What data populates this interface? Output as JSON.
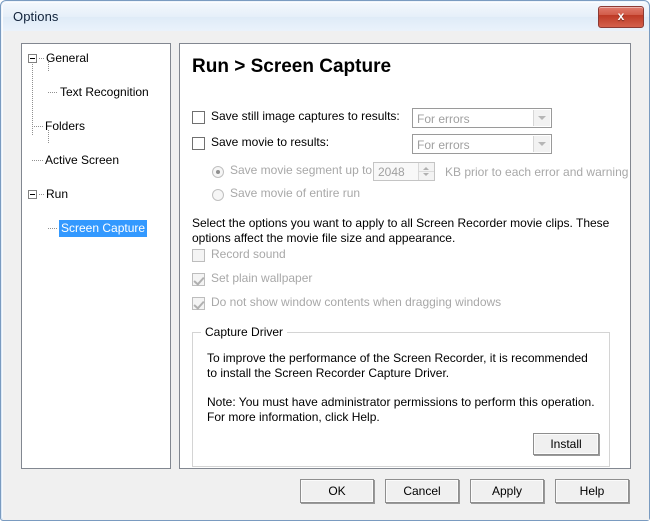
{
  "window": {
    "title": "Options",
    "close_glyph": "x"
  },
  "sidebar": {
    "items": [
      {
        "label": "General",
        "level": 0,
        "expandable": true,
        "selected": false
      },
      {
        "label": "Text Recognition",
        "level": 1,
        "expandable": false,
        "selected": false
      },
      {
        "label": "Folders",
        "level": 0,
        "expandable": false,
        "selected": false
      },
      {
        "label": "Active Screen",
        "level": 0,
        "expandable": false,
        "selected": false
      },
      {
        "label": "Run",
        "level": 0,
        "expandable": true,
        "selected": false
      },
      {
        "label": "Screen Capture",
        "level": 1,
        "expandable": false,
        "selected": true
      }
    ]
  },
  "main": {
    "page_title": "Run > Screen Capture",
    "still_image": {
      "checkbox_label": "Save still image captures to results:",
      "checked": false,
      "combo_value": "For errors"
    },
    "movie": {
      "checkbox_label": "Save movie to results:",
      "checked": false,
      "combo_value": "For errors"
    },
    "movie_segment": {
      "radio_label": "Save movie segment up to",
      "selected": true,
      "spinner_value": "2048",
      "suffix_label": "KB prior to each error and warning"
    },
    "movie_entire": {
      "radio_label": "Save movie of entire run",
      "selected": false
    },
    "description": "Select the options you want to apply to all Screen Recorder movie clips. These options affect the movie file size and appearance.",
    "options": [
      {
        "label": "Record sound",
        "checked": false
      },
      {
        "label": "Set plain wallpaper",
        "checked": true
      },
      {
        "label": "Do not show window contents when dragging windows",
        "checked": true
      }
    ],
    "capture_driver": {
      "title": "Capture Driver",
      "paragraph1": "To improve the performance of the Screen Recorder, it is recommended to install the Screen Recorder Capture Driver.",
      "paragraph2": "Note: You must have administrator permissions to perform this operation. For more information, click Help.",
      "install_label": "Install"
    }
  },
  "footer": {
    "ok_label": "OK",
    "cancel_label": "Cancel",
    "apply_label": "Apply",
    "help_label": "Help"
  },
  "colors": {
    "selection_blue": "#3399ff",
    "close_red": "#bd3a26",
    "panel_bg": "#f0f0f0"
  }
}
